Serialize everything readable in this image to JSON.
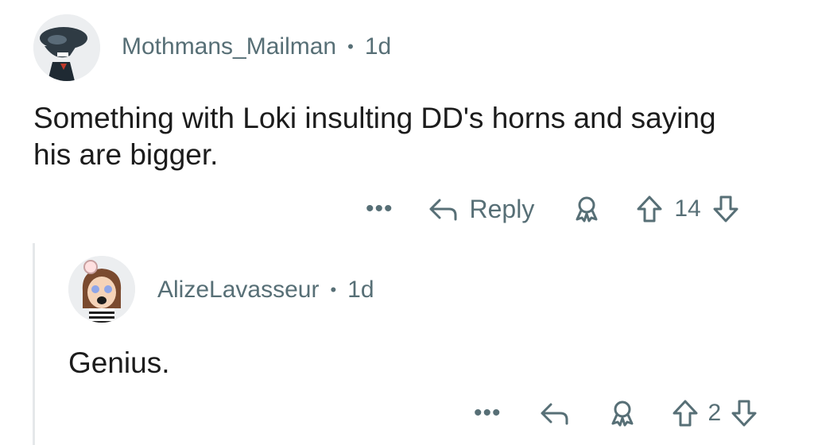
{
  "comments": [
    {
      "username": "Mothmans_Mailman",
      "separator": "•",
      "age": "1d",
      "text_line1": "Something with Loki insulting DD's horns and saying",
      "text_line2": "his are bigger.",
      "actions": {
        "more": "•••",
        "reply_label": "Reply",
        "score": "14"
      }
    },
    {
      "username": "AlizeLavasseur",
      "separator": "•",
      "age": "1d",
      "text": "Genius.",
      "actions": {
        "more": "•••",
        "score": "2"
      }
    }
  ],
  "icons": {
    "avatar1": "alien-avatar",
    "avatar2": "girl-avatar",
    "reply": "reply-arrow-icon",
    "award": "award-icon",
    "upvote": "upvote-arrow-icon",
    "downvote": "downvote-arrow-icon"
  },
  "colors": {
    "meta": "#576f76",
    "text": "#1c1c1c",
    "thread_line": "#e5e8ea"
  }
}
